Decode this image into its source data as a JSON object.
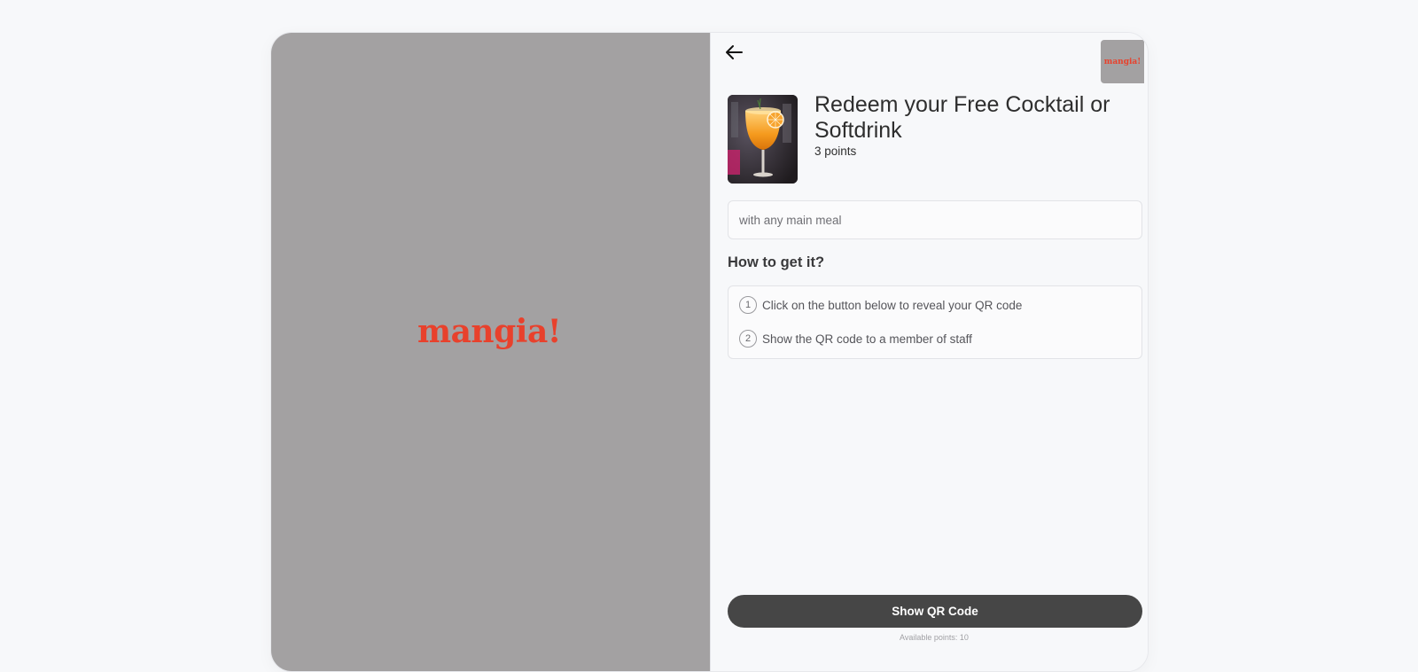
{
  "brand": {
    "logo_text": "mangia!",
    "logo_color": "#e8412c",
    "panel_color": "#a3a1a2"
  },
  "nav": {
    "back_icon": "arrow-left-icon"
  },
  "reward": {
    "title": "Redeem your Free Cocktail or Softdrink",
    "points": "3 points",
    "description": "with any main meal"
  },
  "how_to": {
    "heading": "How to get it?",
    "steps": [
      {
        "number": "1",
        "text": "Click on the button below to reveal your QR code"
      },
      {
        "number": "2",
        "text": "Show the QR code to a member of staff"
      }
    ]
  },
  "actions": {
    "show_qr_label": "Show QR Code",
    "button_color": "#464646"
  },
  "footer": {
    "available_points": "Available points: 10"
  }
}
